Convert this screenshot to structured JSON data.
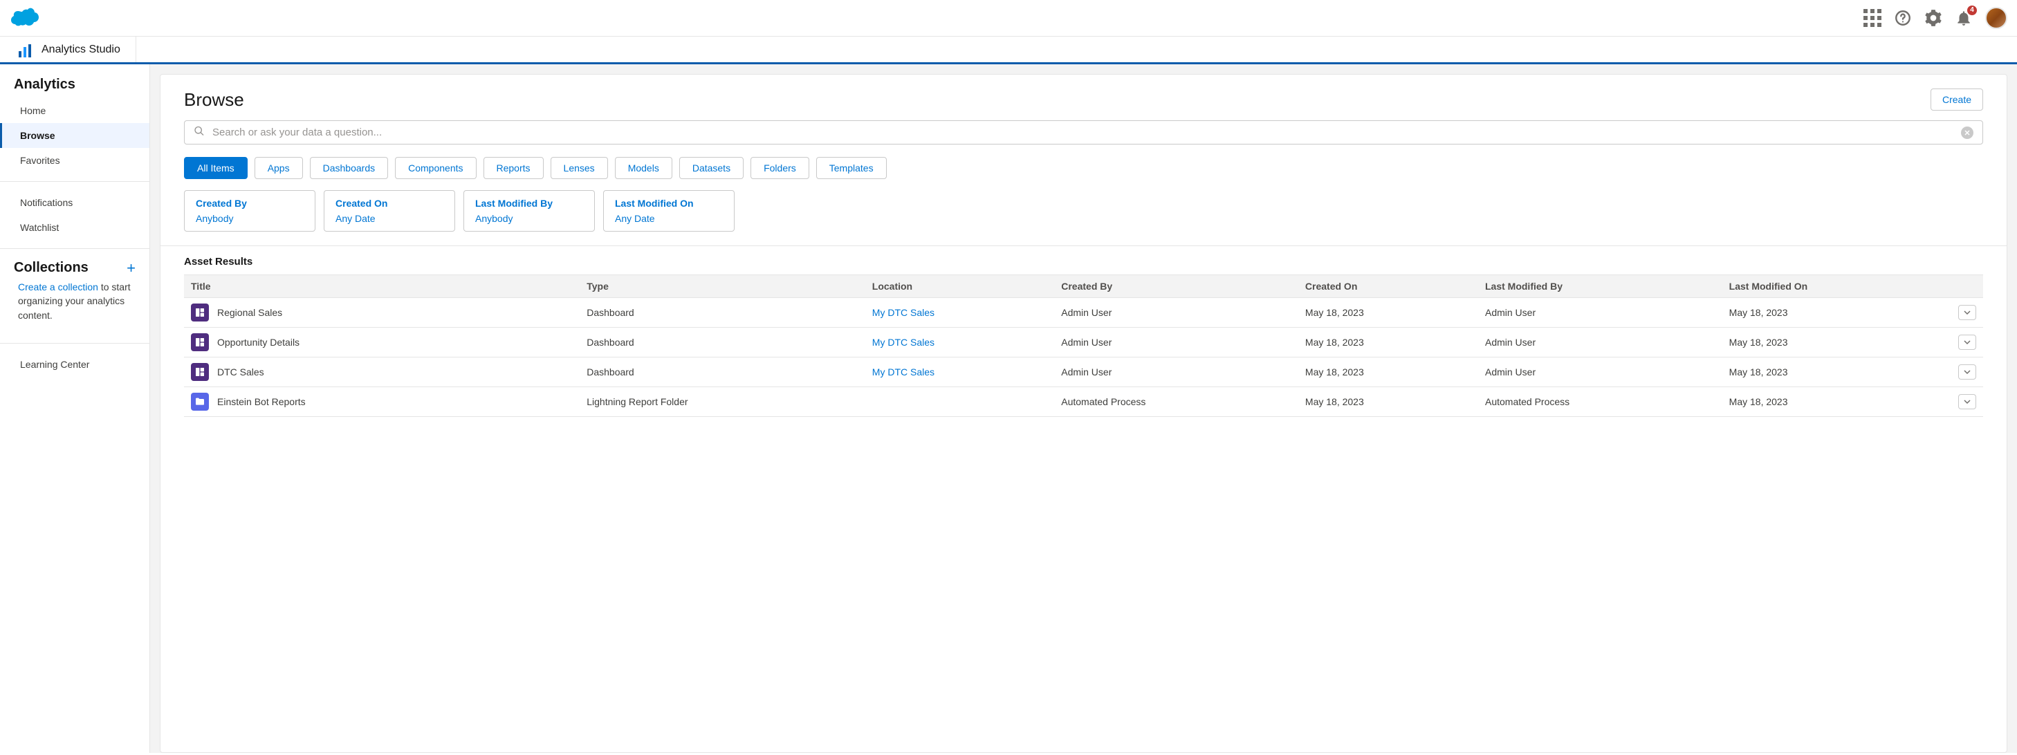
{
  "header": {
    "notification_count": "4"
  },
  "context": {
    "app_name": "Analytics Studio"
  },
  "sidebar": {
    "section1_title": "Analytics",
    "nav": [
      "Home",
      "Browse",
      "Favorites"
    ],
    "active_index": 1,
    "nav2": [
      "Notifications",
      "Watchlist"
    ],
    "collections_title": "Collections",
    "collections_link": "Create a collection",
    "collections_rest": " to start organizing your analytics content.",
    "learning": "Learning Center"
  },
  "browse": {
    "title": "Browse",
    "create_label": "Create",
    "search_placeholder": "Search or ask your data a question...",
    "pills": [
      "All Items",
      "Apps",
      "Dashboards",
      "Components",
      "Reports",
      "Lenses",
      "Models",
      "Datasets",
      "Folders",
      "Templates"
    ],
    "pills_active_index": 0,
    "facets": [
      {
        "label": "Created By",
        "value": "Anybody"
      },
      {
        "label": "Created On",
        "value": "Any Date"
      },
      {
        "label": "Last Modified By",
        "value": "Anybody"
      },
      {
        "label": "Last Modified On",
        "value": "Any Date"
      }
    ],
    "results_title": "Asset Results",
    "columns": [
      "Title",
      "Type",
      "Location",
      "Created By",
      "Created On",
      "Last Modified By",
      "Last Modified On"
    ],
    "rows": [
      {
        "icon": "dash",
        "title": "Regional Sales",
        "type": "Dashboard",
        "location": "My DTC Sales",
        "created_by": "Admin User",
        "created_on": "May 18, 2023",
        "modified_by": "Admin User",
        "modified_on": "May 18, 2023"
      },
      {
        "icon": "dash",
        "title": "Opportunity Details",
        "type": "Dashboard",
        "location": "My DTC Sales",
        "created_by": "Admin User",
        "created_on": "May 18, 2023",
        "modified_by": "Admin User",
        "modified_on": "May 18, 2023"
      },
      {
        "icon": "dash",
        "title": "DTC Sales",
        "type": "Dashboard",
        "location": "My DTC Sales",
        "created_by": "Admin User",
        "created_on": "May 18, 2023",
        "modified_by": "Admin User",
        "modified_on": "May 18, 2023"
      },
      {
        "icon": "folder",
        "title": "Einstein Bot Reports",
        "type": "Lightning Report Folder",
        "location": "",
        "created_by": "Automated Process",
        "created_on": "May 18, 2023",
        "modified_by": "Automated Process",
        "modified_on": "May 18, 2023"
      }
    ]
  }
}
